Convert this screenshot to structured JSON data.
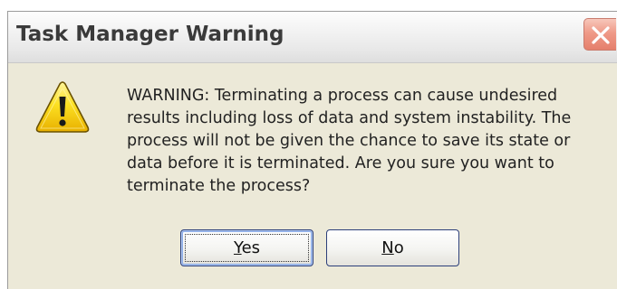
{
  "window": {
    "title": "Task Manager Warning"
  },
  "icons": {
    "warning": "warning-triangle-icon",
    "close": "close-x-icon"
  },
  "message": {
    "lines": [
      "WARNING: Terminating a process can cause undesired",
      "results including loss of data and system instability. The",
      "process will not be given the chance to save its state or",
      "data before it is terminated.  Are you sure you want to",
      "terminate the process?"
    ]
  },
  "buttons": {
    "yes": {
      "mnemonic": "Y",
      "rest": "es"
    },
    "no": {
      "mnemonic": "N",
      "rest": "o"
    }
  },
  "colors": {
    "close_button": "#e57f6c",
    "warning_fill": "#fce022",
    "dialog_background": "#ece9d8"
  }
}
